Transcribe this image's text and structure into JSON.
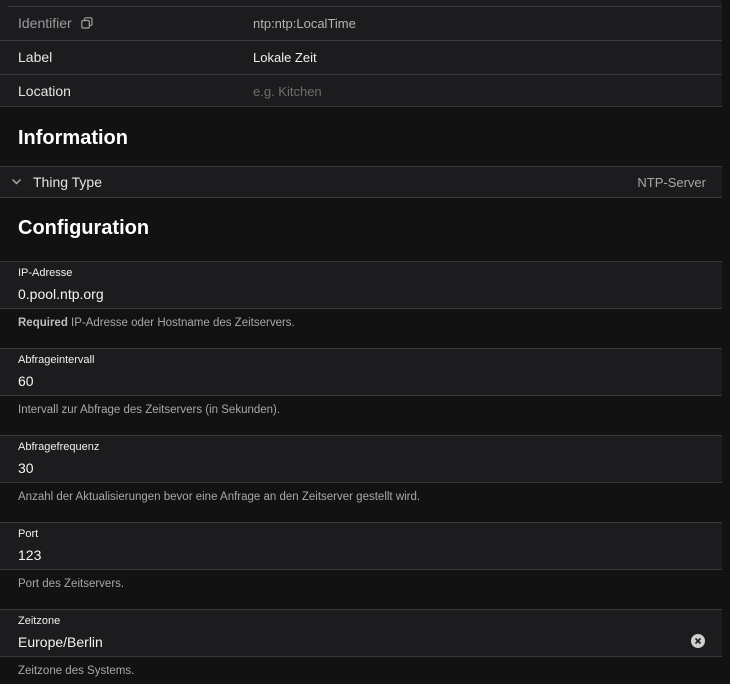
{
  "thing": {
    "identifier_label": "Identifier",
    "identifier_value": "ntp:ntp:LocalTime",
    "label_label": "Label",
    "label_value": "Lokale Zeit",
    "location_label": "Location",
    "location_placeholder": "e.g. Kitchen"
  },
  "information": {
    "title": "Information",
    "thing_type_label": "Thing Type",
    "thing_type_value": "NTP-Server"
  },
  "configuration": {
    "title": "Configuration",
    "fields": [
      {
        "label": "IP-Adresse",
        "value": "0.pool.ntp.org",
        "required": "Required",
        "hint": "IP-Adresse oder Hostname des Zeitservers."
      },
      {
        "label": "Abfrageintervall",
        "value": "60",
        "hint": "Intervall zur Abfrage des Zeitservers (in Sekunden)."
      },
      {
        "label": "Abfragefrequenz",
        "value": "30",
        "hint": "Anzahl der Aktualisierungen bevor eine Anfrage an den Zeitserver gestellt wird."
      },
      {
        "label": "Port",
        "value": "123",
        "hint": "Port des Zeitservers."
      },
      {
        "label": "Zeitzone",
        "value": "Europe/Berlin",
        "hint": "Zeitzone des Systems."
      }
    ]
  },
  "icons": {
    "copy": "copy-icon",
    "chevron": "chevron-down-icon",
    "clear": "clear-icon"
  }
}
